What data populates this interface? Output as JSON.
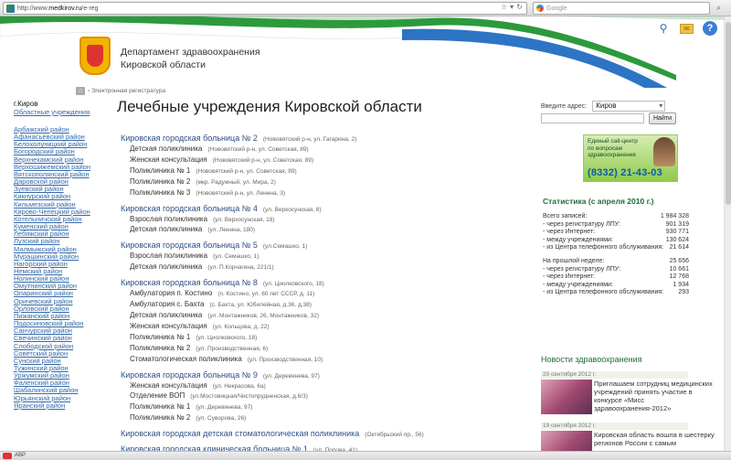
{
  "browser": {
    "url_prefix": "http://www.",
    "url_domain": "medkirov.ru",
    "url_path": "/e-reg",
    "search_placeholder": "Google",
    "status_text": "ABP"
  },
  "header": {
    "dept_line1": "Департамент здравоохранения",
    "dept_line2": "Кировской области"
  },
  "breadcrumb": {
    "text": "› Электронная регистратура"
  },
  "sidebar": {
    "city": "г.Киров",
    "all_link": "Областные учреждения",
    "districts": [
      "Арбажский район",
      "Афанасьевский район",
      "Белохолуницкий район",
      "Богородский район",
      "Верхнекамский район",
      "Верхошижемский район",
      "Вятскополянский район",
      "Даровской район",
      "Зуевский район",
      "Кикнурский район",
      "Кильмезский район",
      "Кирово-Чепецкий район",
      "Котельничский район",
      "Куменский район",
      "Лебяжский район",
      "Лузский район",
      "Малмыжский район",
      "Мурашинский район",
      "Нагорский район",
      "Немский район",
      "Нолинский район",
      "Омутнинский район",
      "Опаринский район",
      "Оричевский район",
      "Орловский район",
      "Пижанский район",
      "Подосиновский район",
      "Санчурский район",
      "Свечинский район",
      "Слободской район",
      "Советский район",
      "Сунский район",
      "Тужинский район",
      "Уржумский район",
      "Фаленский район",
      "Шабалинский район",
      "Юрьянский район",
      "Яранский район"
    ]
  },
  "main": {
    "title": "Лечебные учреждения Кировской области",
    "hospitals": [
      {
        "name": "Кировская городская больница № 2",
        "addr": "(Нововятский р-н, ул. Гагарина, 2)",
        "subs": [
          {
            "name": "Детская поликлиника",
            "addr": "(Нововятский р-н, ул. Советская, 89)"
          },
          {
            "name": "Женская консультация",
            "addr": "(Нововятский р-н, ул. Советская, 89)"
          },
          {
            "name": "Поликлиника № 1",
            "addr": "(Нововятский р-н, ул. Советская, 89)"
          },
          {
            "name": "Поликлиника № 2",
            "addr": "(мкр. Радужный, ул. Мира, 2)"
          },
          {
            "name": "Поликлиника № 3",
            "addr": "(Нововятский р-н, ул. Ленина, 3)"
          }
        ]
      },
      {
        "name": "Кировская городская больница № 4",
        "addr": "(ул. Верхосунская, 8)",
        "subs": [
          {
            "name": "Взрослая поликлиника",
            "addr": "(ул. Верхосунская, 18)"
          },
          {
            "name": "Детская поликлиника",
            "addr": "(ул. Ленина, 180)"
          }
        ]
      },
      {
        "name": "Кировская городская больница № 5",
        "addr": "(ул.Семашко, 1)",
        "subs": [
          {
            "name": "Взрослая поликлиника",
            "addr": "(ул. Семашко, 1)"
          },
          {
            "name": "Детская поликлиника",
            "addr": "(ул. П.Корчагина, 221/1)"
          }
        ]
      },
      {
        "name": "Кировская городская больница № 8",
        "addr": "(ул. Циолковского, 18)",
        "subs": [
          {
            "name": "Амбулатория п. Костино",
            "addr": "(п. Костино, ул. 60 лет СССР, д. 11)"
          },
          {
            "name": "Амбулатория с. Бахта",
            "addr": "(с. Бахта, ул. Юбилейная, д.36, д.38)"
          },
          {
            "name": "Детская поликлиника",
            "addr": "(ул. Монтажников, 26, Монтажников, 32)"
          },
          {
            "name": "Женская консультация",
            "addr": "(ул. Кольцова, д. 22)"
          },
          {
            "name": "Поликлиника № 1",
            "addr": "(ул. Циолковского, 18)"
          },
          {
            "name": "Поликлиника № 2",
            "addr": "(ул. Производственная, 6)"
          },
          {
            "name": "Стоматологическая поликлиника",
            "addr": "(ул. Производственная, 10)"
          }
        ]
      },
      {
        "name": "Кировская городская больница № 9",
        "addr": "(ул. Деревянева, 97)",
        "subs": [
          {
            "name": "Женская консультация",
            "addr": "(ул. Некрасова, 6а)"
          },
          {
            "name": "Отделение ВОП",
            "addr": "(ул.Мостовицкая/Чистопрудненская, д.6/3)"
          },
          {
            "name": "Поликлиника № 1",
            "addr": "(ул. Деревянева, 97)"
          },
          {
            "name": "Поликлиника № 2",
            "addr": "(ул. Суворова, 26)"
          }
        ]
      },
      {
        "name": "Кировская городская детская стоматологическая поликлиника",
        "addr": "(Октябрьский пр., 56)",
        "subs": []
      },
      {
        "name": "Кировская городская клиническая больница № 1",
        "addr": "(ул. Попова, 41)",
        "subs": []
      }
    ]
  },
  "right": {
    "addr_label": "Введите адрес:",
    "addr_city": "Киров",
    "find_button": "Найти",
    "call_center_line1": "Единый call-центр",
    "call_center_line2": "по вопросам",
    "call_center_line3": "здравоохранения",
    "call_center_phone": "(8332) 21-43-03",
    "stats_title": "Статистика (с апреля 2010 г.)",
    "stats_total": [
      {
        "label": "Всего записей:",
        "value": "1 984 328"
      },
      {
        "label": "- через регистратуру ЛПУ:",
        "value": "901 319"
      },
      {
        "label": "- через Интернет:",
        "value": "930 771"
      },
      {
        "label": "- между учреждениями:",
        "value": "130 624"
      },
      {
        "label": "- из Центра телефонного обслуживания:",
        "value": "21 614"
      }
    ],
    "stats_week": [
      {
        "label": "На прошлой неделе:",
        "value": "25 656"
      },
      {
        "label": "- через регистратуру ЛПУ:",
        "value": "10 661"
      },
      {
        "label": "- через Интернет:",
        "value": "12 768"
      },
      {
        "label": "- между учреждениями:",
        "value": "1 934"
      },
      {
        "label": "- из Центра телефонного обслуживания:",
        "value": "293"
      }
    ],
    "news_title": "Новости здравоохранения",
    "news": [
      {
        "date": "20 сентября 2012 г.",
        "text": "Приглашаем сотрудниц медицинских учреждений принять участие в конкурсе «Мисс здравоохранения-2012»"
      },
      {
        "date": "19 сентября 2012 г.",
        "text": "Кировская область вошла в шестерку регионов России с самым"
      }
    ]
  }
}
